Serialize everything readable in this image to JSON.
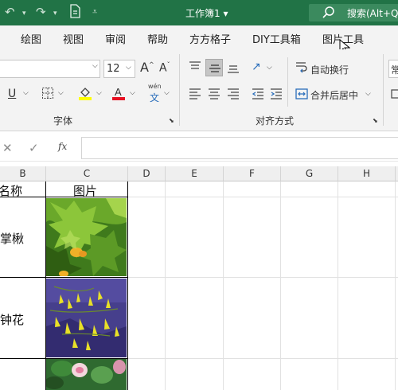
{
  "titlebar": {
    "doc_title": "工作簿1 ▾",
    "search_placeholder": "搜索(Alt+Q)",
    "accent": "#217346"
  },
  "tabs": [
    "绘图",
    "视图",
    "审阅",
    "帮助",
    "方方格子",
    "DIY工具箱",
    "图片工具"
  ],
  "ribbon": {
    "font_size": "12",
    "group_font_label": "字体",
    "group_align_label": "对齐方式",
    "wrap_text_label": "自动换行",
    "merge_center_label": "合并后居中",
    "pinyin_label": "wén"
  },
  "formula_bar": {
    "fx_label": "fx",
    "value": ""
  },
  "grid": {
    "columns": [
      "B",
      "C",
      "D",
      "E",
      "F",
      "G",
      "H"
    ],
    "header_row": {
      "b": "名称",
      "c": "图片"
    },
    "rows": [
      {
        "name": "掌楸",
        "image": "maple-leaf-photo"
      },
      {
        "name": "钟花",
        "image": "yellow-bellflower-photo"
      },
      {
        "name": "",
        "image": "pink-flower-photo"
      }
    ]
  }
}
